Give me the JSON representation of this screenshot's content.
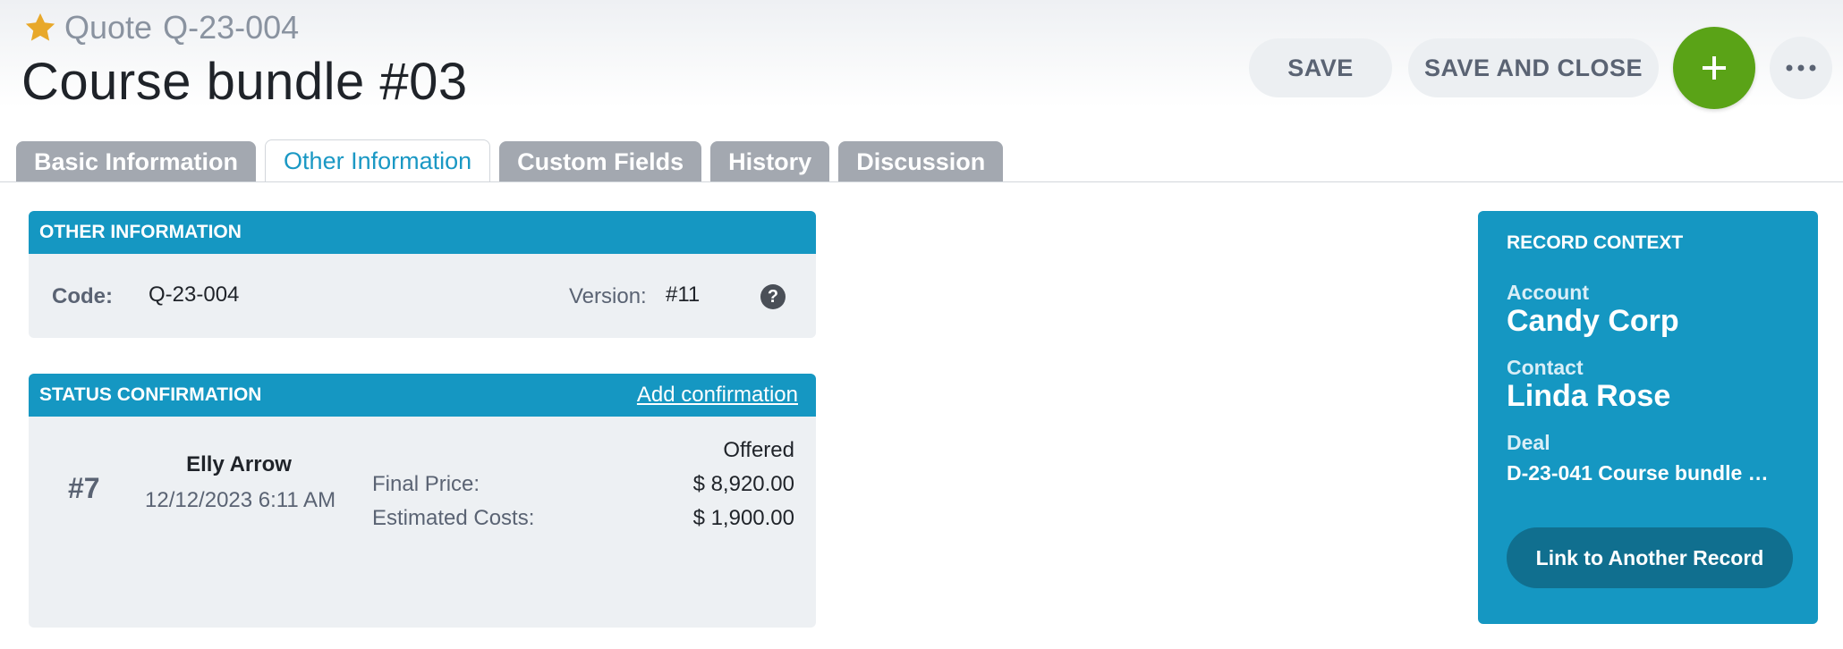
{
  "header": {
    "entity_type": "Quote",
    "entity_id": "Q-23-004",
    "title": "Course bundle #03"
  },
  "actions": {
    "save_label": "SAVE",
    "save_close_label": "SAVE AND CLOSE",
    "add_icon": "plus-icon",
    "more_icon": "ellipsis-icon"
  },
  "tabs": [
    {
      "label": "Basic Information",
      "active": false
    },
    {
      "label": "Other Information",
      "active": true
    },
    {
      "label": "Custom Fields",
      "active": false
    },
    {
      "label": "History",
      "active": false
    },
    {
      "label": "Discussion",
      "active": false
    }
  ],
  "other_information": {
    "heading": "OTHER INFORMATION",
    "code_label": "Code:",
    "code_value": "Q-23-004",
    "version_label": "Version:",
    "version_value": "#11",
    "help_glyph": "?"
  },
  "status_confirmation": {
    "heading": "STATUS CONFIRMATION",
    "add_link": "Add confirmation",
    "entry": {
      "number": "#7",
      "user": "Elly Arrow",
      "datetime": "12/12/2023 6:11 AM",
      "status": "Offered",
      "final_price_label": "Final Price:",
      "final_price_value": "$ 8,920.00",
      "estimated_costs_label": "Estimated Costs:",
      "estimated_costs_value": "$ 1,900.00"
    }
  },
  "record_context": {
    "heading": "RECORD CONTEXT",
    "account_label": "Account",
    "account_value": "Candy Corp",
    "contact_label": "Contact",
    "contact_value": "Linda Rose",
    "deal_label": "Deal",
    "deal_value": "D-23-041 Course bundle …",
    "link_button": "Link to Another Record"
  },
  "colors": {
    "accent": "#1597c2",
    "add_button": "#5aa317",
    "star": "#e8a82a",
    "tab_inactive": "#a3a8b0"
  }
}
